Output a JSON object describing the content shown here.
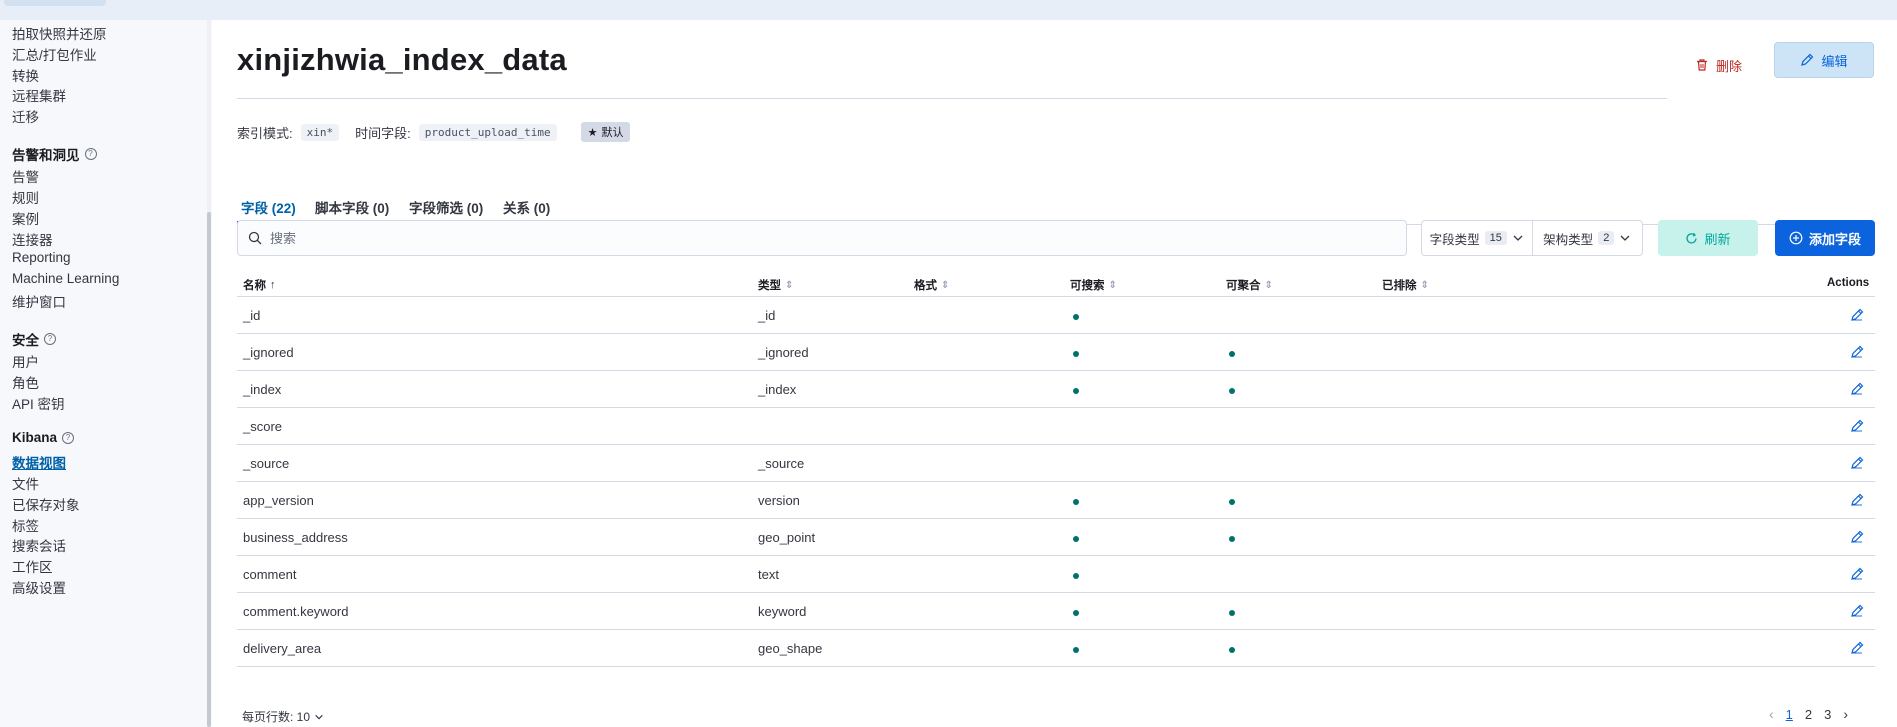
{
  "sidebar": {
    "items": [
      {
        "label": "拍取快照并还原"
      },
      {
        "label": "汇总/打包作业"
      },
      {
        "label": "转换"
      },
      {
        "label": "远程集群"
      },
      {
        "label": "迁移"
      }
    ],
    "groups": [
      {
        "title": "告警和洞见",
        "items": [
          "告警",
          "规则",
          "案例",
          "连接器",
          "Reporting",
          "Machine Learning",
          "维护窗口"
        ]
      },
      {
        "title": "安全",
        "items": [
          "用户",
          "角色",
          "API 密钥"
        ]
      },
      {
        "title": "Kibana",
        "items": [
          "数据视图",
          "文件",
          "已保存对象",
          "标签",
          "搜索会话",
          "工作区",
          "高级设置"
        ]
      }
    ],
    "active_item": "数据视图"
  },
  "header": {
    "title": "xinjizhwia_index_data",
    "delete_label": "删除",
    "edit_label": "编辑"
  },
  "meta": {
    "index_pattern_label": "索引模式:",
    "index_pattern_value": "xin*",
    "time_field_label": "时间字段:",
    "time_field_value": "product_upload_time",
    "default_badge": "默认"
  },
  "tabs": [
    {
      "label": "字段 (22)",
      "active": true
    },
    {
      "label": "脚本字段 (0)",
      "active": false
    },
    {
      "label": "字段筛选 (0)",
      "active": false
    },
    {
      "label": "关系 (0)",
      "active": false
    }
  ],
  "toolbar": {
    "search_placeholder": "搜索",
    "field_type_label": "字段类型",
    "field_type_count": "15",
    "schema_type_label": "架构类型",
    "schema_type_count": "2",
    "refresh_label": "刷新",
    "add_field_label": "添加字段"
  },
  "table": {
    "columns": [
      "名称",
      "类型",
      "格式",
      "可搜索",
      "可聚合",
      "已排除",
      "Actions"
    ],
    "rows": [
      {
        "name": "_id",
        "type": "_id",
        "searchable": true,
        "aggregatable": false
      },
      {
        "name": "_ignored",
        "type": "_ignored",
        "searchable": true,
        "aggregatable": true
      },
      {
        "name": "_index",
        "type": "_index",
        "searchable": true,
        "aggregatable": true
      },
      {
        "name": "_score",
        "type": "",
        "searchable": false,
        "aggregatable": false
      },
      {
        "name": "_source",
        "type": "_source",
        "searchable": false,
        "aggregatable": false
      },
      {
        "name": "app_version",
        "type": "version",
        "searchable": true,
        "aggregatable": true
      },
      {
        "name": "business_address",
        "type": "geo_point",
        "searchable": true,
        "aggregatable": true
      },
      {
        "name": "comment",
        "type": "text",
        "searchable": true,
        "aggregatable": false
      },
      {
        "name": "comment.keyword",
        "type": "keyword",
        "searchable": true,
        "aggregatable": true
      },
      {
        "name": "delivery_area",
        "type": "geo_shape",
        "searchable": true,
        "aggregatable": true
      }
    ]
  },
  "pagination": {
    "rows_per_page_label": "每页行数: 10",
    "pages": [
      "1",
      "2",
      "3"
    ],
    "current_page": "1"
  },
  "colors": {
    "accent": "#0b64dd",
    "danger": "#bd271e",
    "success": "#00726b",
    "refresh_bg": "#c7f2ec"
  }
}
